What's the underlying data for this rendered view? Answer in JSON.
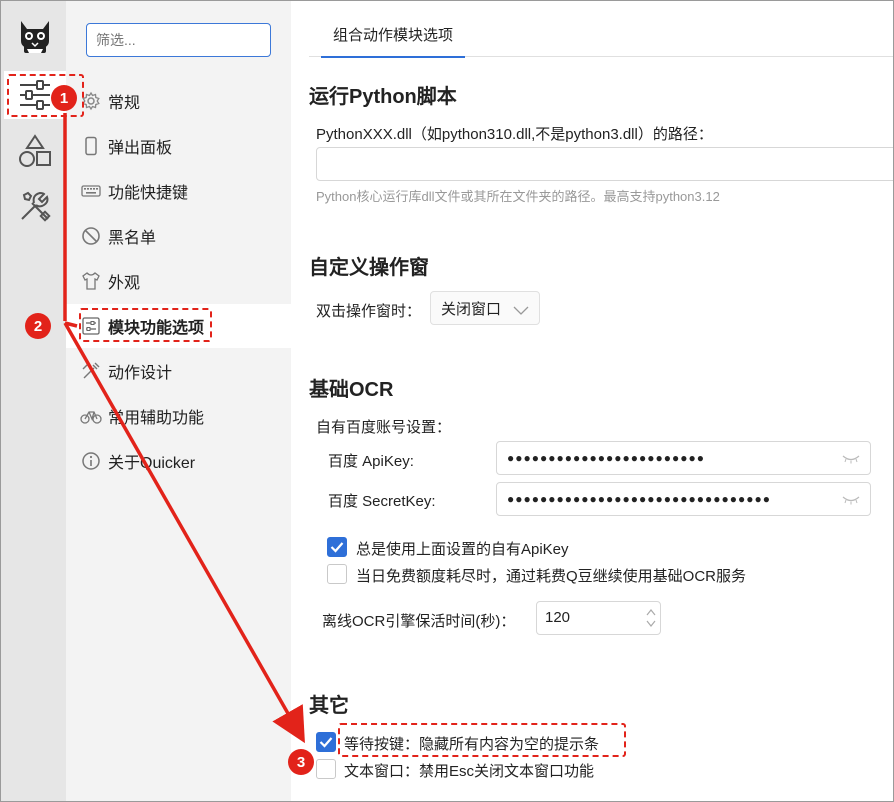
{
  "filter": {
    "placeholder": "筛选..."
  },
  "rail": {
    "icons": [
      "cat-logo-icon",
      "sliders-icon",
      "shapes-icon",
      "tools-icon"
    ]
  },
  "nav": {
    "items": [
      {
        "label": "常规",
        "icon": "gear-icon"
      },
      {
        "label": "弹出面板",
        "icon": "phone-icon"
      },
      {
        "label": "功能快捷键",
        "icon": "keyboard-icon"
      },
      {
        "label": "黑名单",
        "icon": "ban-icon"
      },
      {
        "label": "外观",
        "icon": "shirt-icon"
      },
      {
        "label": "模块功能选项",
        "icon": "sliders-small-icon"
      },
      {
        "label": "动作设计",
        "icon": "design-icon"
      },
      {
        "label": "常用辅助功能",
        "icon": "bicycle-icon"
      },
      {
        "label": "关于Quicker",
        "icon": "info-icon"
      }
    ]
  },
  "tab": {
    "label": "组合动作模块选项"
  },
  "python": {
    "title": "运行Python脚本",
    "path_label": "PythonXXX.dll（如python310.dll,不是python3.dll）的路径：",
    "path_value": "",
    "hint": "Python核心运行库dll文件或其所在文件夹的路径。最高支持python3.12"
  },
  "custom_window": {
    "title": "自定义操作窗",
    "dblclick_label": "双击操作窗时：",
    "dblclick_value": "关闭窗口"
  },
  "ocr": {
    "title": "基础OCR",
    "baidu_label": "自有百度账号设置：",
    "apikey_label": "百度 ApiKey:",
    "apikey_value": "●●●●●●●●●●●●●●●●●●●●●●●●",
    "secret_label": "百度 SecretKey:",
    "secret_value": "●●●●●●●●●●●●●●●●●●●●●●●●●●●●●●●●",
    "always_use_label": "总是使用上面设置的自有ApiKey",
    "always_use_checked": true,
    "free_quota_label": "当日免费额度耗尽时，通过耗费Q豆继续使用基础OCR服务",
    "free_quota_checked": false,
    "keepalive_label": "离线OCR引擎保活时间(秒)：",
    "keepalive_value": "120"
  },
  "other": {
    "title": "其它",
    "wait_key_label": "等待按键：隐藏所有内容为空的提示条",
    "wait_key_checked": true,
    "text_window_label": "文本窗口：禁用Esc关闭文本窗口功能",
    "text_window_checked": false
  },
  "annotations": {
    "badges": [
      "1",
      "2",
      "3"
    ],
    "color": "#e2231a"
  },
  "colors": {
    "accent": "#2e6fd8",
    "rail_bg": "#e6e6e6",
    "nav_bg": "#f3f3f3",
    "annotation": "#e2231a"
  }
}
